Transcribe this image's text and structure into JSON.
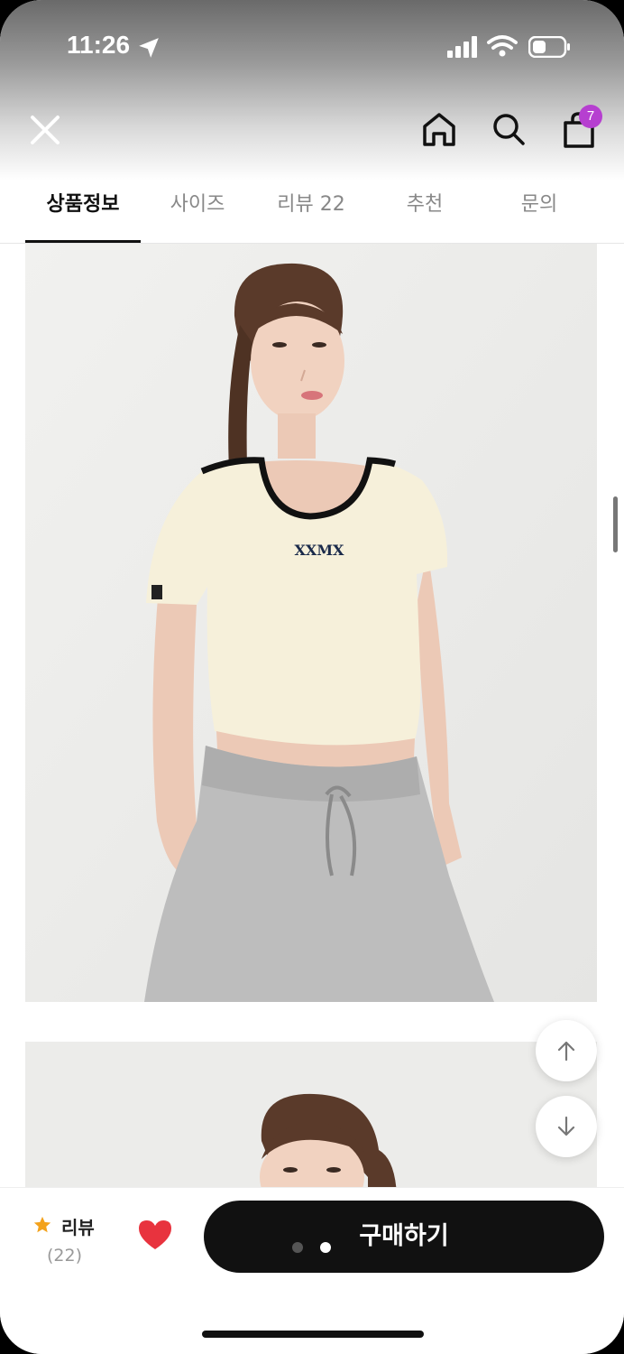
{
  "status_bar": {
    "time": "11:26"
  },
  "header": {
    "cart_badge_count": "7"
  },
  "tabs": [
    {
      "label": "상품정보",
      "active": true
    },
    {
      "label": "사이즈",
      "active": false
    },
    {
      "label": "리뷰 22",
      "active": false
    },
    {
      "label": "추천",
      "active": false
    },
    {
      "label": "문의",
      "active": false
    }
  ],
  "product_image": {
    "shirt_print": "XXMX"
  },
  "bottom_bar": {
    "review_label": "리뷰",
    "review_count": "(22)",
    "buy_label": "구매하기"
  },
  "colors": {
    "accent_star": "#f3a21c",
    "heart": "#e8333e",
    "badge": "#b63fd0",
    "buy_button": "#111111"
  },
  "icons": [
    "close-icon",
    "home-icon",
    "search-icon",
    "shopping-bag-icon",
    "arrow-up-icon",
    "arrow-down-icon",
    "star-icon",
    "heart-icon"
  ]
}
